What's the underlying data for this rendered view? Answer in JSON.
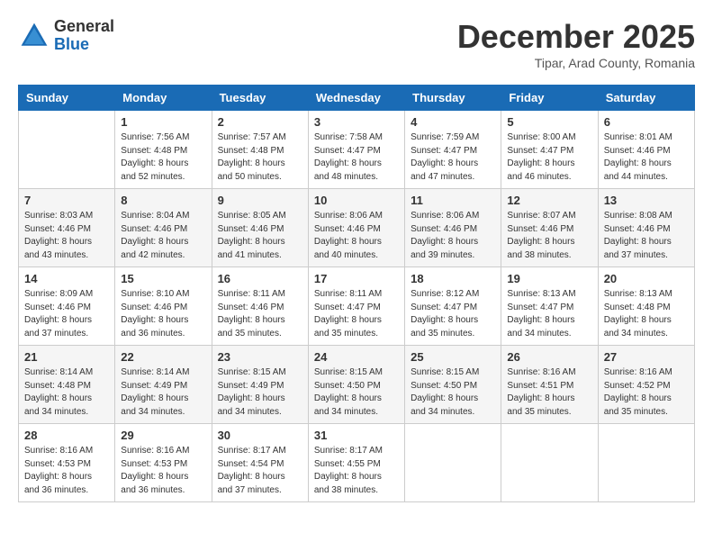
{
  "header": {
    "logo_general": "General",
    "logo_blue": "Blue",
    "month_title": "December 2025",
    "location": "Tipar, Arad County, Romania"
  },
  "days_of_week": [
    "Sunday",
    "Monday",
    "Tuesday",
    "Wednesday",
    "Thursday",
    "Friday",
    "Saturday"
  ],
  "weeks": [
    [
      {
        "day": "",
        "sunrise": "",
        "sunset": "",
        "daylight": ""
      },
      {
        "day": "1",
        "sunrise": "Sunrise: 7:56 AM",
        "sunset": "Sunset: 4:48 PM",
        "daylight": "Daylight: 8 hours and 52 minutes."
      },
      {
        "day": "2",
        "sunrise": "Sunrise: 7:57 AM",
        "sunset": "Sunset: 4:48 PM",
        "daylight": "Daylight: 8 hours and 50 minutes."
      },
      {
        "day": "3",
        "sunrise": "Sunrise: 7:58 AM",
        "sunset": "Sunset: 4:47 PM",
        "daylight": "Daylight: 8 hours and 48 minutes."
      },
      {
        "day": "4",
        "sunrise": "Sunrise: 7:59 AM",
        "sunset": "Sunset: 4:47 PM",
        "daylight": "Daylight: 8 hours and 47 minutes."
      },
      {
        "day": "5",
        "sunrise": "Sunrise: 8:00 AM",
        "sunset": "Sunset: 4:47 PM",
        "daylight": "Daylight: 8 hours and 46 minutes."
      },
      {
        "day": "6",
        "sunrise": "Sunrise: 8:01 AM",
        "sunset": "Sunset: 4:46 PM",
        "daylight": "Daylight: 8 hours and 44 minutes."
      }
    ],
    [
      {
        "day": "7",
        "sunrise": "Sunrise: 8:03 AM",
        "sunset": "Sunset: 4:46 PM",
        "daylight": "Daylight: 8 hours and 43 minutes."
      },
      {
        "day": "8",
        "sunrise": "Sunrise: 8:04 AM",
        "sunset": "Sunset: 4:46 PM",
        "daylight": "Daylight: 8 hours and 42 minutes."
      },
      {
        "day": "9",
        "sunrise": "Sunrise: 8:05 AM",
        "sunset": "Sunset: 4:46 PM",
        "daylight": "Daylight: 8 hours and 41 minutes."
      },
      {
        "day": "10",
        "sunrise": "Sunrise: 8:06 AM",
        "sunset": "Sunset: 4:46 PM",
        "daylight": "Daylight: 8 hours and 40 minutes."
      },
      {
        "day": "11",
        "sunrise": "Sunrise: 8:06 AM",
        "sunset": "Sunset: 4:46 PM",
        "daylight": "Daylight: 8 hours and 39 minutes."
      },
      {
        "day": "12",
        "sunrise": "Sunrise: 8:07 AM",
        "sunset": "Sunset: 4:46 PM",
        "daylight": "Daylight: 8 hours and 38 minutes."
      },
      {
        "day": "13",
        "sunrise": "Sunrise: 8:08 AM",
        "sunset": "Sunset: 4:46 PM",
        "daylight": "Daylight: 8 hours and 37 minutes."
      }
    ],
    [
      {
        "day": "14",
        "sunrise": "Sunrise: 8:09 AM",
        "sunset": "Sunset: 4:46 PM",
        "daylight": "Daylight: 8 hours and 37 minutes."
      },
      {
        "day": "15",
        "sunrise": "Sunrise: 8:10 AM",
        "sunset": "Sunset: 4:46 PM",
        "daylight": "Daylight: 8 hours and 36 minutes."
      },
      {
        "day": "16",
        "sunrise": "Sunrise: 8:11 AM",
        "sunset": "Sunset: 4:46 PM",
        "daylight": "Daylight: 8 hours and 35 minutes."
      },
      {
        "day": "17",
        "sunrise": "Sunrise: 8:11 AM",
        "sunset": "Sunset: 4:47 PM",
        "daylight": "Daylight: 8 hours and 35 minutes."
      },
      {
        "day": "18",
        "sunrise": "Sunrise: 8:12 AM",
        "sunset": "Sunset: 4:47 PM",
        "daylight": "Daylight: 8 hours and 35 minutes."
      },
      {
        "day": "19",
        "sunrise": "Sunrise: 8:13 AM",
        "sunset": "Sunset: 4:47 PM",
        "daylight": "Daylight: 8 hours and 34 minutes."
      },
      {
        "day": "20",
        "sunrise": "Sunrise: 8:13 AM",
        "sunset": "Sunset: 4:48 PM",
        "daylight": "Daylight: 8 hours and 34 minutes."
      }
    ],
    [
      {
        "day": "21",
        "sunrise": "Sunrise: 8:14 AM",
        "sunset": "Sunset: 4:48 PM",
        "daylight": "Daylight: 8 hours and 34 minutes."
      },
      {
        "day": "22",
        "sunrise": "Sunrise: 8:14 AM",
        "sunset": "Sunset: 4:49 PM",
        "daylight": "Daylight: 8 hours and 34 minutes."
      },
      {
        "day": "23",
        "sunrise": "Sunrise: 8:15 AM",
        "sunset": "Sunset: 4:49 PM",
        "daylight": "Daylight: 8 hours and 34 minutes."
      },
      {
        "day": "24",
        "sunrise": "Sunrise: 8:15 AM",
        "sunset": "Sunset: 4:50 PM",
        "daylight": "Daylight: 8 hours and 34 minutes."
      },
      {
        "day": "25",
        "sunrise": "Sunrise: 8:15 AM",
        "sunset": "Sunset: 4:50 PM",
        "daylight": "Daylight: 8 hours and 34 minutes."
      },
      {
        "day": "26",
        "sunrise": "Sunrise: 8:16 AM",
        "sunset": "Sunset: 4:51 PM",
        "daylight": "Daylight: 8 hours and 35 minutes."
      },
      {
        "day": "27",
        "sunrise": "Sunrise: 8:16 AM",
        "sunset": "Sunset: 4:52 PM",
        "daylight": "Daylight: 8 hours and 35 minutes."
      }
    ],
    [
      {
        "day": "28",
        "sunrise": "Sunrise: 8:16 AM",
        "sunset": "Sunset: 4:53 PM",
        "daylight": "Daylight: 8 hours and 36 minutes."
      },
      {
        "day": "29",
        "sunrise": "Sunrise: 8:16 AM",
        "sunset": "Sunset: 4:53 PM",
        "daylight": "Daylight: 8 hours and 36 minutes."
      },
      {
        "day": "30",
        "sunrise": "Sunrise: 8:17 AM",
        "sunset": "Sunset: 4:54 PM",
        "daylight": "Daylight: 8 hours and 37 minutes."
      },
      {
        "day": "31",
        "sunrise": "Sunrise: 8:17 AM",
        "sunset": "Sunset: 4:55 PM",
        "daylight": "Daylight: 8 hours and 38 minutes."
      },
      {
        "day": "",
        "sunrise": "",
        "sunset": "",
        "daylight": ""
      },
      {
        "day": "",
        "sunrise": "",
        "sunset": "",
        "daylight": ""
      },
      {
        "day": "",
        "sunrise": "",
        "sunset": "",
        "daylight": ""
      }
    ]
  ]
}
